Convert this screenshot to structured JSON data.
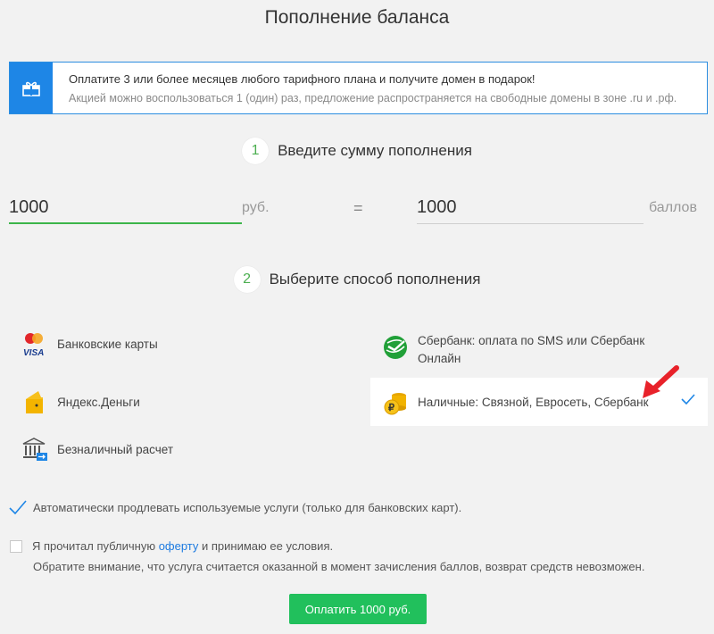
{
  "page": {
    "title": "Пополнение баланса"
  },
  "promo": {
    "line1": "Оплатите 3 или более месяцев любого тарифного плана и получите домен в подарок!",
    "line2": "Акцией можно воспользоваться 1 (один) раз, предложение распространяется на свободные домены в зоне .ru и .рф.",
    "icon": "gift-icon",
    "accent": "#1e86e6"
  },
  "step1": {
    "number": "1",
    "label": "Введите сумму пополнения"
  },
  "amount": {
    "value": "1000",
    "unit": "руб.",
    "equals": "=",
    "points_value": "1000",
    "points_unit": "баллов"
  },
  "step2": {
    "number": "2",
    "label": "Выберите способ пополнения"
  },
  "methods": {
    "bank_cards": "Банковские карты",
    "yandex": "Яндекс.Деньги",
    "bank_transfer": "Безналичный расчет",
    "sberbank_sms": "Сбербанк: оплата по SMS или Сбербанк Онлайн",
    "cash": "Наличные: Связной, Евросеть, Сбербанк"
  },
  "autorenew": {
    "label": "Автоматически продлевать используемые услуги (только для банковских карт)."
  },
  "agree": {
    "before": "Я прочитал публичную ",
    "link": "оферту",
    "after": " и принимаю ее условия."
  },
  "note": "Обратите внимание, что услуга считается оказанной в момент зачисления баллов, возврат средств невозможен.",
  "pay_button": "Оплатить 1000 руб.",
  "colors": {
    "green": "#21c05c",
    "blue": "#1e86e6",
    "arrow": "#e8222a"
  }
}
